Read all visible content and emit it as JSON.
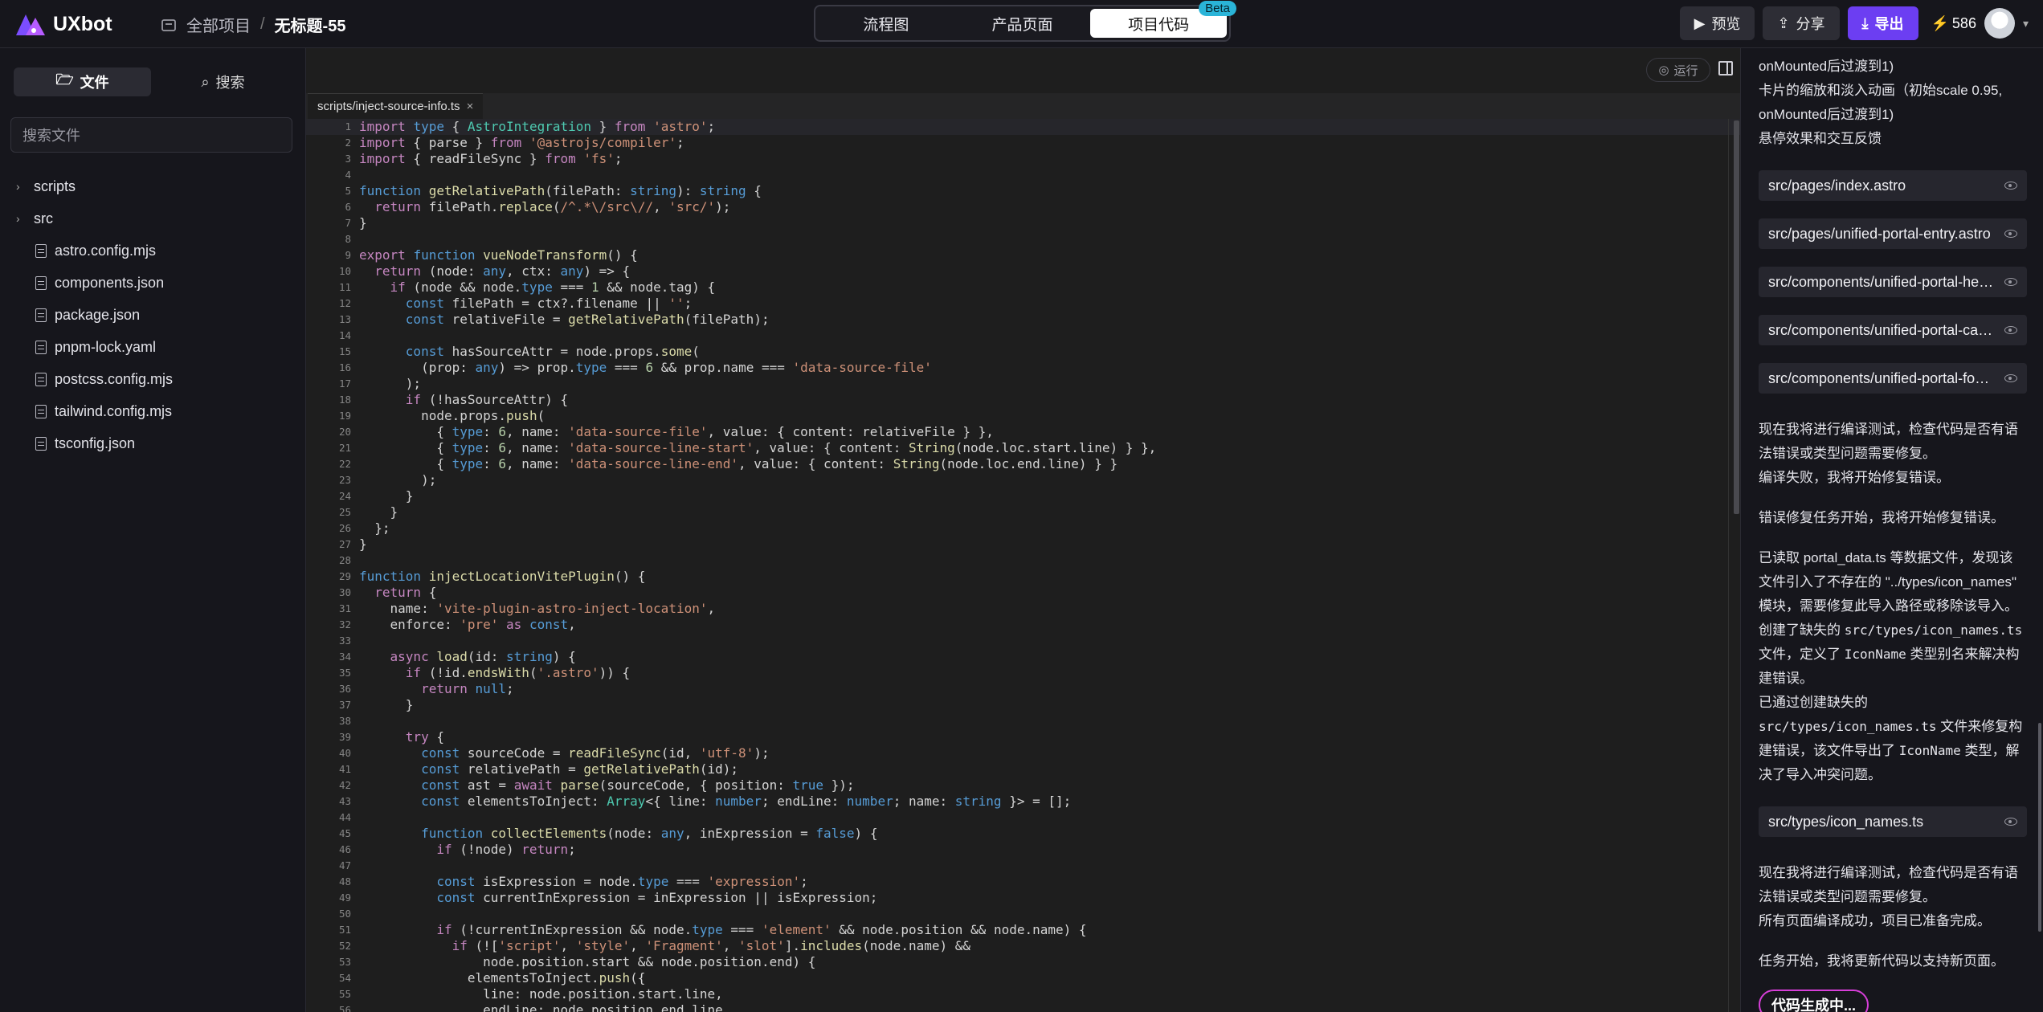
{
  "header": {
    "logo_text": "UXbot",
    "crumb_all": "全部项目",
    "crumb_sep": "/",
    "crumb_title": "无标题-55",
    "tabs": [
      "流程图",
      "产品页面",
      "项目代码"
    ],
    "active_tab": "项目代码",
    "beta": "Beta",
    "preview": "预览",
    "share": "分享",
    "export": "导出",
    "credits": "586",
    "accent_color": "#6c3ef2"
  },
  "sidebar": {
    "tab_files": "文件",
    "tab_search": "搜索",
    "search_placeholder": "搜索文件",
    "folders": [
      "scripts",
      "src"
    ],
    "files": [
      "astro.config.mjs",
      "components.json",
      "package.json",
      "pnpm-lock.yaml",
      "postcss.config.mjs",
      "tailwind.config.mjs",
      "tsconfig.json"
    ]
  },
  "editor": {
    "run_label": "运行",
    "open_file": "scripts/inject-source-info.ts",
    "lines": [
      "import type { AstroIntegration } from 'astro';",
      "import { parse } from '@astrojs/compiler';",
      "import { readFileSync } from 'fs';",
      "",
      "function getRelativePath(filePath: string): string {",
      "  return filePath.replace(/^.*\\/src\\//, 'src/');",
      "}",
      "",
      "export function vueNodeTransform() {",
      "  return (node: any, ctx: any) => {",
      "    if (node && node.type === 1 && node.tag) {",
      "      const filePath = ctx?.filename || '';",
      "      const relativeFile = getRelativePath(filePath);",
      "",
      "      const hasSourceAttr = node.props.some(",
      "        (prop: any) => prop.type === 6 && prop.name === 'data-source-file'",
      "      );",
      "      if (!hasSourceAttr) {",
      "        node.props.push(",
      "          { type: 6, name: 'data-source-file', value: { content: relativeFile } },",
      "          { type: 6, name: 'data-source-line-start', value: { content: String(node.loc.start.line) } },",
      "          { type: 6, name: 'data-source-line-end', value: { content: String(node.loc.end.line) } }",
      "        );",
      "      }",
      "    }",
      "  };",
      "}",
      "",
      "function injectLocationVitePlugin() {",
      "  return {",
      "    name: 'vite-plugin-astro-inject-location',",
      "    enforce: 'pre' as const,",
      "",
      "    async load(id: string) {",
      "      if (!id.endsWith('.astro')) {",
      "        return null;",
      "      }",
      "",
      "      try {",
      "        const sourceCode = readFileSync(id, 'utf-8');",
      "        const relativePath = getRelativePath(id);",
      "        const ast = await parse(sourceCode, { position: true });",
      "        const elementsToInject: Array<{ line: number; endLine: number; name: string }> = [];",
      "",
      "        function collectElements(node: any, inExpression = false) {",
      "          if (!node) return;",
      "",
      "          const isExpression = node.type === 'expression';",
      "          const currentInExpression = inExpression || isExpression;",
      "",
      "          if (!currentInExpression && node.type === 'element' && node.position && node.name) {",
      "            if (!['script', 'style', 'Fragment', 'slot'].includes(node.name) &&",
      "                node.position.start && node.position.end) {",
      "              elementsToInject.push({",
      "                line: node.position.start.line,",
      "                endLine: node.position.end.line,"
    ]
  },
  "chat": {
    "intro": [
      "onMounted后过渡到1)",
      "卡片的缩放和淡入动画（初始scale 0.95,",
      "onMounted后过渡到1)",
      "悬停效果和交互反馈"
    ],
    "files": [
      "src/pages/index.astro",
      "src/pages/unified-portal-entry.astro",
      "src/components/unified-portal-header.vue",
      "src/components/unified-portal-cards.vue",
      "src/components/unified-portal-footer.vue"
    ],
    "msg1": [
      "现在我将进行编译测试，检查代码是否有语",
      "法错误或类型问题需要修复。",
      "编译失败，我将开始修复错误。"
    ],
    "msg2": "错误修复任务开始，我将开始修复错误。",
    "msg3_lines": [
      "已读取 portal_data.ts 等数据文件，发现该",
      "文件引入了不存在的 \"../types/icon_names\"",
      "模块，需要修复此导入路径或移除该导入。"
    ],
    "msg3_code_a": "src/types/icon_names.ts",
    "msg3_code_b": "IconName",
    "msg3_t1": "创建了缺失的 ",
    "msg3_t2": "文件，定义了 ",
    "msg3_t3": " 类型别名来解决构",
    "msg3_t4": "建错误。",
    "msg3_t5": "已通过创建缺失的",
    "msg3_t6": " 文件来修复构",
    "msg3_t7": "建错误，该文件导出了 ",
    "msg3_t8": " 类型，解",
    "msg3_t9": "决了导入冲突问题。",
    "file_chip2": "src/types/icon_names.ts",
    "msg4": [
      "现在我将进行编译测试，检查代码是否有语",
      "法错误或类型问题需要修复。",
      "所有页面编译成功，项目已准备完成。"
    ],
    "msg5": "任务开始，我将更新代码以支持新页面。",
    "generating": "代码生成中..."
  }
}
